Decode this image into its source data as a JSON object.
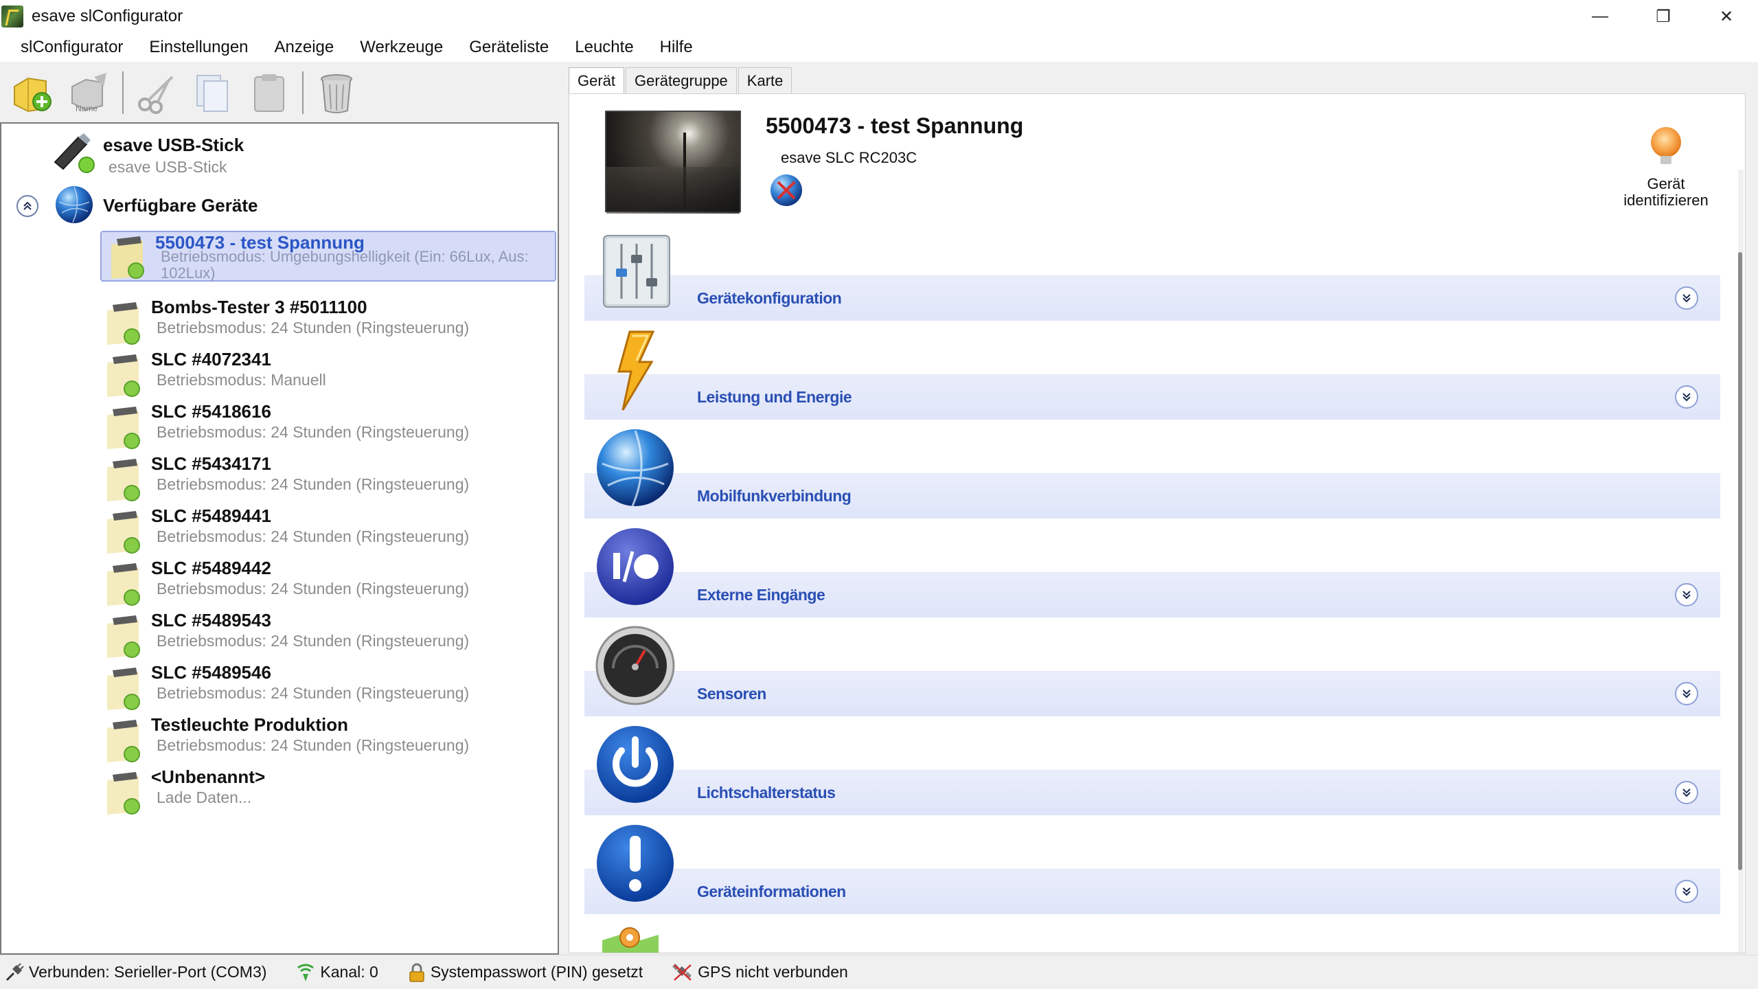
{
  "window": {
    "title": "esave slConfigurator",
    "controls": {
      "minimize": "—",
      "restore": "❐",
      "close": "✕"
    }
  },
  "menu": [
    "slConfigurator",
    "Einstellungen",
    "Anzeige",
    "Werkzeuge",
    "Geräteliste",
    "Leuchte",
    "Hilfe"
  ],
  "toolbar": {
    "buttons": [
      "add-device",
      "rename",
      "cut",
      "copy",
      "paste",
      "delete"
    ],
    "rename_caption": "Name"
  },
  "tree": {
    "usb": {
      "title": "esave USB-Stick",
      "subtitle": "esave USB-Stick"
    },
    "available": {
      "title": "Verfügbare Geräte"
    },
    "devices": [
      {
        "title": "5500473 - test  Spannung",
        "subtitle": "Betriebsmodus: Umgebungshelligkeit (Ein: 66Lux, Aus: 102Lux)",
        "selected": true
      },
      {
        "title": "Bombs-Tester 3 #5011100",
        "subtitle": "Betriebsmodus: 24 Stunden (Ringsteuerung)"
      },
      {
        "title": "SLC #4072341",
        "subtitle": "Betriebsmodus: Manuell"
      },
      {
        "title": "SLC #5418616",
        "subtitle": "Betriebsmodus: 24 Stunden (Ringsteuerung)"
      },
      {
        "title": "SLC #5434171",
        "subtitle": "Betriebsmodus: 24 Stunden (Ringsteuerung)"
      },
      {
        "title": "SLC #5489441",
        "subtitle": "Betriebsmodus: 24 Stunden (Ringsteuerung)"
      },
      {
        "title": "SLC #5489442",
        "subtitle": "Betriebsmodus: 24 Stunden (Ringsteuerung)"
      },
      {
        "title": "SLC #5489543",
        "subtitle": "Betriebsmodus: 24 Stunden (Ringsteuerung)"
      },
      {
        "title": "SLC #5489546",
        "subtitle": "Betriebsmodus: 24 Stunden (Ringsteuerung)"
      },
      {
        "title": "Testleuchte Produktion",
        "subtitle": "Betriebsmodus: 24 Stunden (Ringsteuerung)"
      },
      {
        "title": "<Unbenannt>",
        "subtitle": "Lade Daten..."
      }
    ]
  },
  "tabs": [
    "Gerät",
    "Gerätegruppe",
    "Karte"
  ],
  "device": {
    "heading": "5500473 - test Spannung",
    "model": "esave SLC RC203C",
    "identify_line1": "Gerät",
    "identify_line2": "identifizieren"
  },
  "sections": [
    {
      "label": "Gerätekonfiguration",
      "icon": "sliders-icon",
      "expandable": true
    },
    {
      "label": "Leistung und Energie",
      "icon": "lightning-icon",
      "expandable": true
    },
    {
      "label": "Mobilfunkverbindung",
      "icon": "globe-icon",
      "expandable": false
    },
    {
      "label": "Externe Eingänge",
      "icon": "io-icon",
      "expandable": true
    },
    {
      "label": "Sensoren",
      "icon": "gauge-icon",
      "expandable": true
    },
    {
      "label": "Lichtschalterstatus",
      "icon": "power-icon",
      "expandable": true
    },
    {
      "label": "Geräteinformationen",
      "icon": "info-icon",
      "expandable": true
    }
  ],
  "status": {
    "connection": "Verbunden: Serieller-Port (COM3)",
    "channel": "Kanal: 0",
    "password": "Systempasswort (PIN) gesetzt",
    "gps": "GPS nicht verbunden"
  },
  "colors": {
    "accent": "#2a4fb4",
    "selection_bg": "#d6dcf7",
    "section_bar": "#e5eafb"
  }
}
